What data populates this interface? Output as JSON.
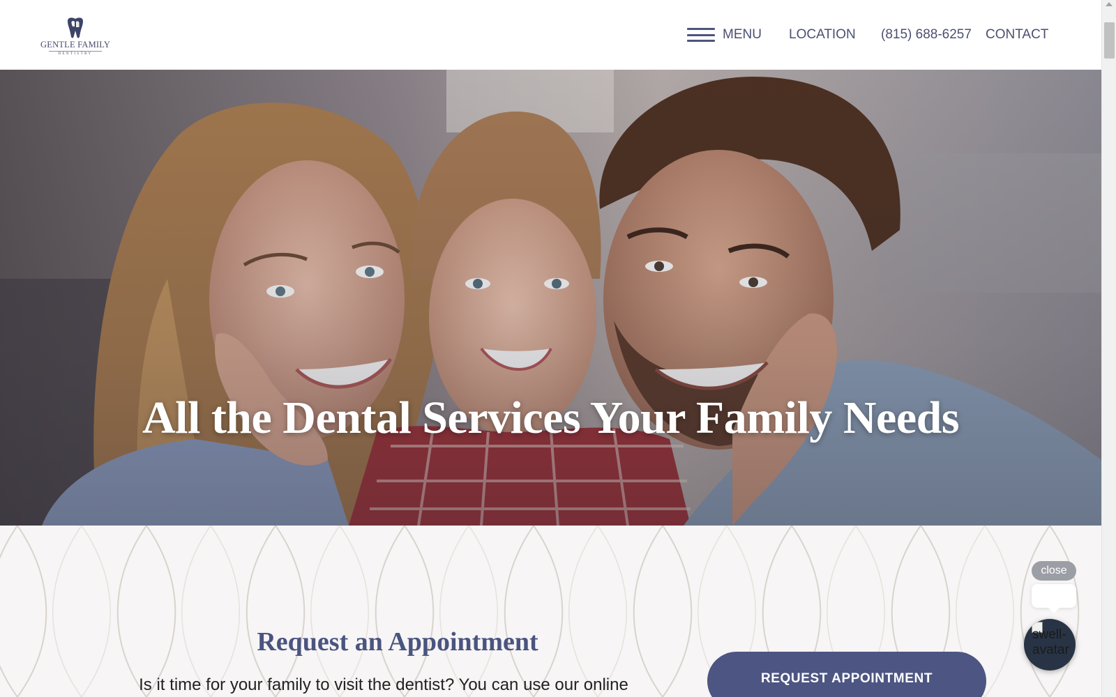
{
  "header": {
    "logo": {
      "name": "GENTLE FAMILY",
      "subtitle": "DENTISTRY"
    },
    "nav": {
      "menu_label": "MENU",
      "location_label": "LOCATION",
      "phone_label": "(815) 688-6257",
      "contact_label": "CONTACT"
    }
  },
  "hero": {
    "headline": "All the Dental Services Your Family Needs"
  },
  "appointment": {
    "title": "Request an Appointment",
    "text": "Is it time for your family to visit the dentist? You can use our online",
    "button_label": "REQUEST APPOINTMENT"
  },
  "chat_widget": {
    "close_label": "close",
    "avatar_alt": "swell-avatar"
  },
  "colors": {
    "brand": "#4d5582",
    "nav_text": "#4a5070",
    "section_bg": "#f7f5f5"
  }
}
